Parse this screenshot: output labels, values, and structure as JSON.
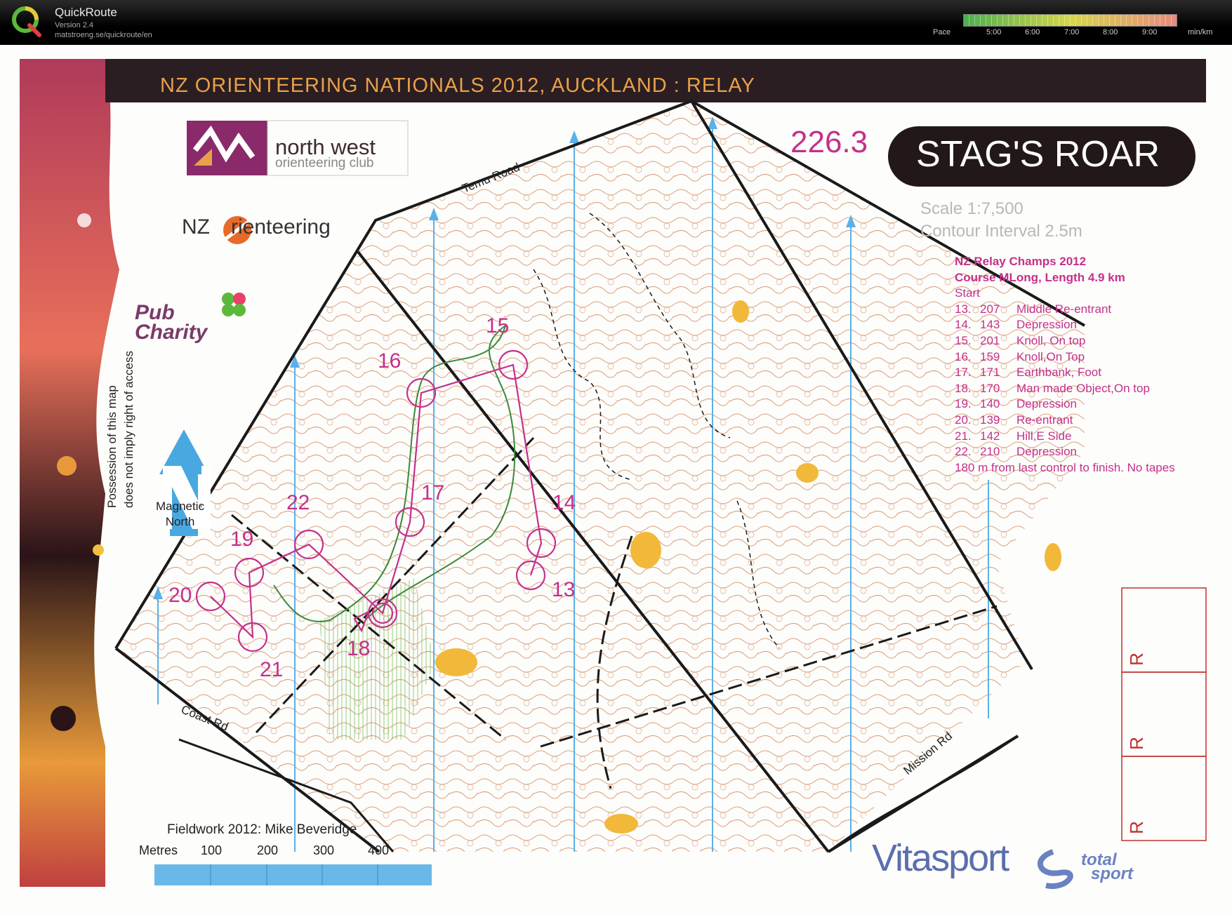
{
  "quickroute": {
    "app_name": "QuickRoute",
    "version": "Version 2.4",
    "url": "matstroeng.se/quickroute/en",
    "pace_label": "Pace",
    "pace_ticks": [
      "5:00",
      "6:00",
      "7:00",
      "8:00",
      "9:00"
    ],
    "pace_unit": "min/km",
    "pace_colors": [
      "#4caf50",
      "#d6d64a",
      "#e88a80"
    ]
  },
  "map": {
    "title": "NZ ORIENTEERING NATIONALS 2012, AUCKLAND  :  RELAY",
    "code": "226.3",
    "name": "STAG'S ROAR",
    "scale": "Scale 1:7,500",
    "contour_interval": "Contour Interval 2.5m",
    "magnetic_north": [
      "Magnetic",
      "North"
    ],
    "possession_notice": [
      "Possession of this map",
      "does not imply right of access"
    ],
    "fieldwork": "Fieldwork 2012: Mike Beveridge",
    "scale_bar": {
      "unit_label": "Metres",
      "ticks": [
        "100",
        "200",
        "300",
        "400"
      ]
    },
    "roads": {
      "temu": "Temu Road",
      "coast": "Coast Rd",
      "mission": "Mission Rd"
    },
    "colors": {
      "course": "#c4308a",
      "contour": "#c87040",
      "title_bar": "#2a1e22",
      "title_text": "#e8a04a",
      "north_arrow": "#4aa8e0",
      "meridian": "#5ab0e8",
      "route": "#3a8a3a"
    }
  },
  "sponsors": {
    "club_name": "north west",
    "club_sub": "orienteering club",
    "nzo_prefix": "NZ",
    "nzo_suffix": "rienteering",
    "pub": "Pub",
    "charity": "Charity",
    "vitasport": "Vitasport",
    "totalsport_1": "total",
    "totalsport_2": "sport"
  },
  "course": {
    "header1": "NZ Relay Champs 2012",
    "header2": "Course MLong,  Length 4.9 km",
    "start": "Start",
    "controls": [
      {
        "num": "13.",
        "code": "207",
        "desc": "Middle Re-entrant"
      },
      {
        "num": "14.",
        "code": "143",
        "desc": "Depression"
      },
      {
        "num": "15.",
        "code": "201",
        "desc": "Knoll, On top"
      },
      {
        "num": "16.",
        "code": "159",
        "desc": "Knoll,On Top"
      },
      {
        "num": "17.",
        "code": "171",
        "desc": "Earthbank, Foot"
      },
      {
        "num": "18.",
        "code": "170",
        "desc": "Man made Object,On top"
      },
      {
        "num": "19.",
        "code": "140",
        "desc": "Depression"
      },
      {
        "num": "20.",
        "code": "139",
        "desc": "Re-entrant"
      },
      {
        "num": "21.",
        "code": "142",
        "desc": "Hill,E Side"
      },
      {
        "num": "22.",
        "code": "210",
        "desc": "Depression"
      }
    ],
    "finish_note": "180 m from last control to finish. No tapes"
  },
  "control_labels": [
    "13",
    "14",
    "15",
    "16",
    "17",
    "18",
    "19",
    "20",
    "21",
    "22"
  ],
  "relay_boxes": [
    "R",
    "R",
    "R"
  ]
}
